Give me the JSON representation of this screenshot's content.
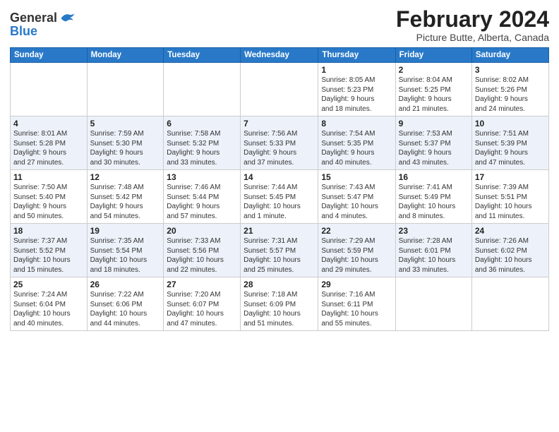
{
  "header": {
    "logo_line1": "General",
    "logo_line2": "Blue",
    "title": "February 2024",
    "subtitle": "Picture Butte, Alberta, Canada"
  },
  "weekdays": [
    "Sunday",
    "Monday",
    "Tuesday",
    "Wednesday",
    "Thursday",
    "Friday",
    "Saturday"
  ],
  "rows": [
    [
      {
        "day": "",
        "info": ""
      },
      {
        "day": "",
        "info": ""
      },
      {
        "day": "",
        "info": ""
      },
      {
        "day": "",
        "info": ""
      },
      {
        "day": "1",
        "info": "Sunrise: 8:05 AM\nSunset: 5:23 PM\nDaylight: 9 hours\nand 18 minutes."
      },
      {
        "day": "2",
        "info": "Sunrise: 8:04 AM\nSunset: 5:25 PM\nDaylight: 9 hours\nand 21 minutes."
      },
      {
        "day": "3",
        "info": "Sunrise: 8:02 AM\nSunset: 5:26 PM\nDaylight: 9 hours\nand 24 minutes."
      }
    ],
    [
      {
        "day": "4",
        "info": "Sunrise: 8:01 AM\nSunset: 5:28 PM\nDaylight: 9 hours\nand 27 minutes."
      },
      {
        "day": "5",
        "info": "Sunrise: 7:59 AM\nSunset: 5:30 PM\nDaylight: 9 hours\nand 30 minutes."
      },
      {
        "day": "6",
        "info": "Sunrise: 7:58 AM\nSunset: 5:32 PM\nDaylight: 9 hours\nand 33 minutes."
      },
      {
        "day": "7",
        "info": "Sunrise: 7:56 AM\nSunset: 5:33 PM\nDaylight: 9 hours\nand 37 minutes."
      },
      {
        "day": "8",
        "info": "Sunrise: 7:54 AM\nSunset: 5:35 PM\nDaylight: 9 hours\nand 40 minutes."
      },
      {
        "day": "9",
        "info": "Sunrise: 7:53 AM\nSunset: 5:37 PM\nDaylight: 9 hours\nand 43 minutes."
      },
      {
        "day": "10",
        "info": "Sunrise: 7:51 AM\nSunset: 5:39 PM\nDaylight: 9 hours\nand 47 minutes."
      }
    ],
    [
      {
        "day": "11",
        "info": "Sunrise: 7:50 AM\nSunset: 5:40 PM\nDaylight: 9 hours\nand 50 minutes."
      },
      {
        "day": "12",
        "info": "Sunrise: 7:48 AM\nSunset: 5:42 PM\nDaylight: 9 hours\nand 54 minutes."
      },
      {
        "day": "13",
        "info": "Sunrise: 7:46 AM\nSunset: 5:44 PM\nDaylight: 9 hours\nand 57 minutes."
      },
      {
        "day": "14",
        "info": "Sunrise: 7:44 AM\nSunset: 5:45 PM\nDaylight: 10 hours\nand 1 minute."
      },
      {
        "day": "15",
        "info": "Sunrise: 7:43 AM\nSunset: 5:47 PM\nDaylight: 10 hours\nand 4 minutes."
      },
      {
        "day": "16",
        "info": "Sunrise: 7:41 AM\nSunset: 5:49 PM\nDaylight: 10 hours\nand 8 minutes."
      },
      {
        "day": "17",
        "info": "Sunrise: 7:39 AM\nSunset: 5:51 PM\nDaylight: 10 hours\nand 11 minutes."
      }
    ],
    [
      {
        "day": "18",
        "info": "Sunrise: 7:37 AM\nSunset: 5:52 PM\nDaylight: 10 hours\nand 15 minutes."
      },
      {
        "day": "19",
        "info": "Sunrise: 7:35 AM\nSunset: 5:54 PM\nDaylight: 10 hours\nand 18 minutes."
      },
      {
        "day": "20",
        "info": "Sunrise: 7:33 AM\nSunset: 5:56 PM\nDaylight: 10 hours\nand 22 minutes."
      },
      {
        "day": "21",
        "info": "Sunrise: 7:31 AM\nSunset: 5:57 PM\nDaylight: 10 hours\nand 25 minutes."
      },
      {
        "day": "22",
        "info": "Sunrise: 7:29 AM\nSunset: 5:59 PM\nDaylight: 10 hours\nand 29 minutes."
      },
      {
        "day": "23",
        "info": "Sunrise: 7:28 AM\nSunset: 6:01 PM\nDaylight: 10 hours\nand 33 minutes."
      },
      {
        "day": "24",
        "info": "Sunrise: 7:26 AM\nSunset: 6:02 PM\nDaylight: 10 hours\nand 36 minutes."
      }
    ],
    [
      {
        "day": "25",
        "info": "Sunrise: 7:24 AM\nSunset: 6:04 PM\nDaylight: 10 hours\nand 40 minutes."
      },
      {
        "day": "26",
        "info": "Sunrise: 7:22 AM\nSunset: 6:06 PM\nDaylight: 10 hours\nand 44 minutes."
      },
      {
        "day": "27",
        "info": "Sunrise: 7:20 AM\nSunset: 6:07 PM\nDaylight: 10 hours\nand 47 minutes."
      },
      {
        "day": "28",
        "info": "Sunrise: 7:18 AM\nSunset: 6:09 PM\nDaylight: 10 hours\nand 51 minutes."
      },
      {
        "day": "29",
        "info": "Sunrise: 7:16 AM\nSunset: 6:11 PM\nDaylight: 10 hours\nand 55 minutes."
      },
      {
        "day": "",
        "info": ""
      },
      {
        "day": "",
        "info": ""
      }
    ]
  ]
}
